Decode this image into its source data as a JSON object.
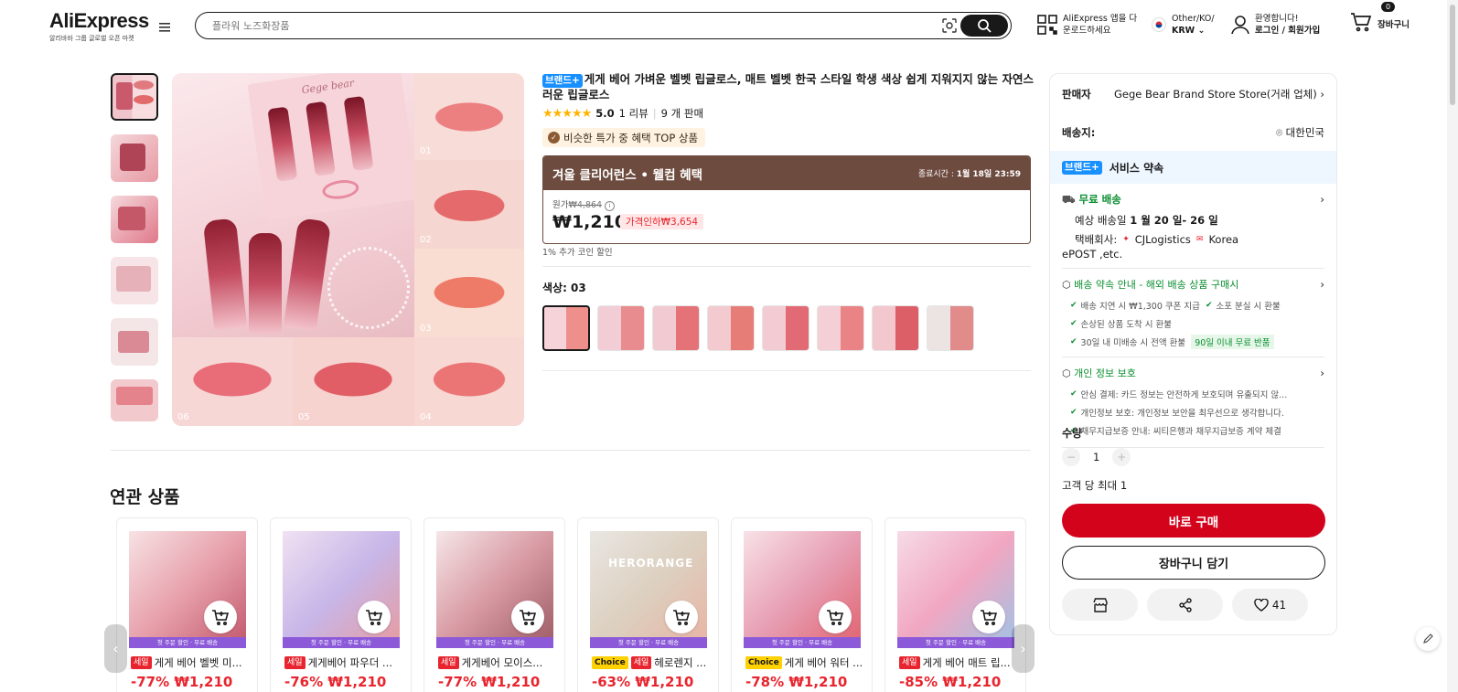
{
  "header": {
    "logo": "AliExpress",
    "logo_tagline": "알리바바 그룹 글로벌 오픈 마켓",
    "search_placeholder": "플라워 노즈화장품",
    "app_line1": "AliExpress 앱을 다",
    "app_line2": "운로드하세요",
    "region_line1": "Other/KO/",
    "region_line2": "KRW",
    "account_line1": "환영합니다!",
    "account_line2": "로그인 / 회원가입",
    "cart_count": "0",
    "cart_label": "장바구니"
  },
  "gallery": {
    "numbers": [
      "01",
      "02",
      "03",
      "04",
      "05",
      "06"
    ],
    "brand_text": "Gege bear"
  },
  "product": {
    "brand_badge": "브랜드+",
    "title": "게게 베어 가벼운 벨벳 립글로스, 매트 벨벳 한국 스타일 학생 색상 쉽게 지워지지 않는 자연스러운 립글로스",
    "rating": "5.0",
    "reviews": "1 리뷰",
    "sold": "9 개 판매",
    "top_badge": "비슷한 특가 중 혜택 TOP 상품",
    "deal_title": "겨울 클리어런스 • 웰컴 혜택",
    "deal_end_label": "종료시간 :",
    "deal_end_time": "1월 18일 23:59",
    "orig_label": "원가",
    "orig_price": "₩4,864",
    "price": "₩1,210",
    "discount": "가격인하₩3,654",
    "coin": "1% 추가 코인 할인",
    "color_label": "색상: 03"
  },
  "panel": {
    "seller_label": "판매자",
    "seller_value": "Gege Bear Brand Store Store(거래 업체)",
    "ship_to_label": "배송지:",
    "ship_to_value": "대한민국",
    "service_badge": "브랜드+",
    "service_title": "서비스 약속",
    "free_ship": "무료 배송",
    "eta_prefix": "예상 배송일",
    "eta": "1 월 20 일- 26 일",
    "carrier_label": "택배회사:",
    "carrier1": "CJLogistics",
    "carrier2": "Korea",
    "carrier3": "ePOST ,etc.",
    "promise_title": "배송 약속 안내 - 해외 배송 상품 구매시",
    "promise1": "배송 지연 시 ₩1,300 쿠폰 지급",
    "promise2": "소포 분실 시 환불",
    "promise3": "손상된 상품 도착 시 환불",
    "promise4": "30일 내 미배송 시 전액 환불",
    "promise4_badge": "90일 이내 무료 반품",
    "privacy_title": "개인 정보 보호",
    "privacy1": "안심 결제: 카드 정보는 안전하게 보호되며 유출되지 않...",
    "privacy2": "개인정보 보호: 개인정보 보안을 최우선으로 생각합니다.",
    "privacy3": "채무지급보증 안내: 씨티은행과 채무지급보증 계약 체결",
    "qty_label": "수량",
    "qty_value": "1",
    "qty_limit": "고객 당 최대 1",
    "buy_now": "바로 구매",
    "add_cart": "장바구니 담기",
    "likes": "41"
  },
  "related": {
    "title": "연관 상품",
    "strip_text": "첫 주문 할인 · 무료 배송",
    "items": [
      {
        "tags": [
          "세일"
        ],
        "name": "게게 베어 벨벳 미...",
        "discount": "-77%",
        "price": "₩1,210"
      },
      {
        "tags": [
          "세일"
        ],
        "name": "게게베어 파우더 ...",
        "discount": "-76%",
        "price": "₩1,210"
      },
      {
        "tags": [
          "세일"
        ],
        "name": "게게베어 모이스...",
        "discount": "-77%",
        "price": "₩1,210"
      },
      {
        "tags": [
          "Choice",
          "세일"
        ],
        "name": "헤로렌지 ...",
        "discount": "-63%",
        "price": "₩1,210"
      },
      {
        "tags": [
          "Choice"
        ],
        "name": "게게 베어 워터 ...",
        "discount": "-78%",
        "price": "₩1,210"
      },
      {
        "tags": [
          "세일"
        ],
        "name": "게게 베어 매트 립...",
        "discount": "-85%",
        "price": "₩1,210"
      }
    ],
    "card4_brand": "HERORANGE"
  },
  "colors": {
    "price_red": "#e8252e",
    "buy_red": "#d3031c",
    "deal_brown": "#6e4b3f",
    "green": "#0a8e2f",
    "brand_blue": "#1890ff"
  }
}
